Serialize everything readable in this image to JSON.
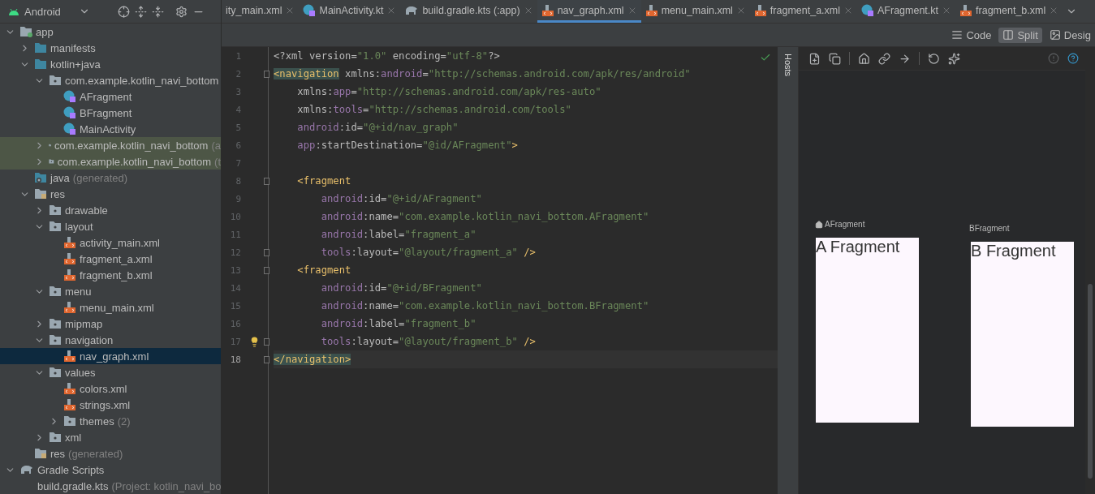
{
  "project_view": {
    "title": "Android"
  },
  "tree": [
    {
      "label": "app",
      "kind": "module",
      "expanded": true,
      "selected": false,
      "highlighted": false,
      "children": [
        {
          "label": "manifests",
          "kind": "folder",
          "expanded": false,
          "selected": false,
          "highlighted": false
        },
        {
          "label": "kotlin+java",
          "kind": "folder",
          "expanded": true,
          "selected": false,
          "highlighted": false,
          "children": [
            {
              "label": "com.example.kotlin_navi_bottom",
              "kind": "package",
              "expanded": true,
              "selected": false,
              "highlighted": false,
              "children": [
                {
                  "label": "AFragment",
                  "kind": "kotlin",
                  "selected": false,
                  "highlighted": false
                },
                {
                  "label": "BFragment",
                  "kind": "kotlin",
                  "selected": false,
                  "highlighted": false
                },
                {
                  "label": "MainActivity",
                  "kind": "kotlin",
                  "selected": false,
                  "highlighted": false
                }
              ]
            },
            {
              "label": "com.example.kotlin_navi_bottom",
              "suffix": "(a",
              "kind": "package",
              "expanded": false,
              "selected": false,
              "highlighted": true
            },
            {
              "label": "com.example.kotlin_navi_bottom",
              "suffix": "(t",
              "kind": "package",
              "expanded": false,
              "selected": false,
              "highlighted": true
            }
          ]
        },
        {
          "label": "java",
          "suffix": "(generated)",
          "kind": "generated",
          "selected": false,
          "highlighted": false
        },
        {
          "label": "res",
          "kind": "res",
          "expanded": true,
          "selected": false,
          "highlighted": false,
          "children": [
            {
              "label": "drawable",
              "kind": "package",
              "expanded": false,
              "selected": false,
              "highlighted": false
            },
            {
              "label": "layout",
              "kind": "package",
              "expanded": true,
              "selected": false,
              "highlighted": false,
              "children": [
                {
                  "label": "activity_main.xml",
                  "kind": "xml",
                  "selected": false,
                  "highlighted": false
                },
                {
                  "label": "fragment_a.xml",
                  "kind": "xml",
                  "selected": false,
                  "highlighted": false
                },
                {
                  "label": "fragment_b.xml",
                  "kind": "xml",
                  "selected": false,
                  "highlighted": false
                }
              ]
            },
            {
              "label": "menu",
              "kind": "package",
              "expanded": true,
              "selected": false,
              "highlighted": false,
              "children": [
                {
                  "label": "menu_main.xml",
                  "kind": "xml",
                  "selected": false,
                  "highlighted": false
                }
              ]
            },
            {
              "label": "mipmap",
              "kind": "package",
              "expanded": false,
              "selected": false,
              "highlighted": false
            },
            {
              "label": "navigation",
              "kind": "package",
              "expanded": true,
              "selected": false,
              "highlighted": false,
              "children": [
                {
                  "label": "nav_graph.xml",
                  "kind": "xml",
                  "selected": true
                }
              ]
            },
            {
              "label": "values",
              "kind": "package",
              "expanded": true,
              "selected": false,
              "highlighted": false,
              "children": [
                {
                  "label": "colors.xml",
                  "kind": "xml",
                  "selected": false,
                  "highlighted": false
                },
                {
                  "label": "strings.xml",
                  "kind": "xml",
                  "selected": false,
                  "highlighted": false
                },
                {
                  "label": "themes",
                  "suffix": "(2)",
                  "kind": "package",
                  "expanded": false,
                  "selected": false,
                  "highlighted": false
                }
              ]
            },
            {
              "label": "xml",
              "kind": "package",
              "expanded": false,
              "selected": false,
              "highlighted": false
            }
          ]
        },
        {
          "label": "res",
          "suffix": "(generated)",
          "kind": "res",
          "selected": false,
          "highlighted": false
        }
      ]
    },
    {
      "label": "Gradle Scripts",
      "kind": "gradle",
      "expanded": true,
      "selected": false,
      "highlighted": false,
      "children": [
        {
          "label": "build.gradle.kts",
          "suffix": "(Project: kotlin_navi_bo",
          "kind": "gradle-kts",
          "selected": false,
          "highlighted": false
        }
      ]
    }
  ],
  "tabs": [
    {
      "label": "ity_main.xml",
      "kind": "none",
      "selected": false
    },
    {
      "label": "MainActivity.kt",
      "kind": "kotlin",
      "selected": false
    },
    {
      "label": "build.gradle.kts (:app)",
      "kind": "gradle",
      "selected": false
    },
    {
      "label": "nav_graph.xml",
      "kind": "xml",
      "selected": true
    },
    {
      "label": "menu_main.xml",
      "kind": "xml",
      "selected": false
    },
    {
      "label": "fragment_a.xml",
      "kind": "xml",
      "selected": false
    },
    {
      "label": "AFragment.kt",
      "kind": "kotlin",
      "selected": false
    },
    {
      "label": "fragment_b.xml",
      "kind": "xml",
      "selected": false
    }
  ],
  "view_modes": [
    {
      "label": "Code",
      "kind": "code",
      "selected": false
    },
    {
      "label": "Split",
      "kind": "split",
      "selected": true
    },
    {
      "label": "Desig",
      "kind": "design",
      "selected": false
    }
  ],
  "code_lines": [
    {
      "number": "1",
      "fold": false,
      "bulb": false,
      "current": false,
      "tokens": [
        {
          "kind": "plain",
          "text": "<?xml version="
        },
        {
          "kind": "str",
          "text": "\"1.0\" "
        },
        {
          "kind": "plain",
          "text": "encoding="
        },
        {
          "kind": "str",
          "text": "\"utf-8\""
        },
        {
          "kind": "plain",
          "text": "?>"
        }
      ]
    },
    {
      "number": "2",
      "fold": true,
      "bulb": false,
      "current": false,
      "tokens": [
        {
          "kind": "match",
          "text": "<navigation"
        },
        {
          "kind": "plain",
          "text": " xmlns:"
        },
        {
          "kind": "ns",
          "text": "android"
        },
        {
          "kind": "plain",
          "text": "="
        },
        {
          "kind": "str",
          "text": "\"http://schemas.android.com/apk/res/android\""
        }
      ]
    },
    {
      "number": "3",
      "fold": false,
      "bulb": false,
      "current": false,
      "tokens": [
        {
          "kind": "plain",
          "text": "    xmlns:"
        },
        {
          "kind": "ns",
          "text": "app"
        },
        {
          "kind": "plain",
          "text": "="
        },
        {
          "kind": "str",
          "text": "\"http://schemas.android.com/apk/res-auto\""
        }
      ]
    },
    {
      "number": "4",
      "fold": false,
      "bulb": false,
      "current": false,
      "tokens": [
        {
          "kind": "plain",
          "text": "    xmlns:"
        },
        {
          "kind": "ns",
          "text": "tools"
        },
        {
          "kind": "plain",
          "text": "="
        },
        {
          "kind": "str",
          "text": "\"http://schemas.android.com/tools\""
        }
      ]
    },
    {
      "number": "5",
      "fold": false,
      "bulb": false,
      "current": false,
      "tokens": [
        {
          "kind": "ns",
          "text": "    android"
        },
        {
          "kind": "plain",
          "text": ":id="
        },
        {
          "kind": "str",
          "text": "\"@+id/nav_graph\""
        }
      ]
    },
    {
      "number": "6",
      "fold": false,
      "bulb": false,
      "current": false,
      "tokens": [
        {
          "kind": "ns",
          "text": "    app"
        },
        {
          "kind": "plain",
          "text": ":startDestination="
        },
        {
          "kind": "str",
          "text": "\"@id/AFragment\""
        },
        {
          "kind": "tag",
          "text": ">"
        }
      ]
    },
    {
      "number": "7",
      "fold": false,
      "bulb": false,
      "current": false
    },
    {
      "number": "8",
      "fold": true,
      "bulb": false,
      "current": false,
      "tokens": [
        {
          "kind": "tag",
          "text": "    <fragment"
        }
      ]
    },
    {
      "number": "9",
      "fold": false,
      "bulb": false,
      "current": false,
      "tokens": [
        {
          "kind": "ns",
          "text": "        android"
        },
        {
          "kind": "plain",
          "text": ":id="
        },
        {
          "kind": "str",
          "text": "\"@+id/AFragment\""
        }
      ]
    },
    {
      "number": "10",
      "fold": false,
      "bulb": false,
      "current": false,
      "tokens": [
        {
          "kind": "ns",
          "text": "        android"
        },
        {
          "kind": "plain",
          "text": ":name="
        },
        {
          "kind": "str",
          "text": "\"com.example.kotlin_navi_bottom.AFragment\""
        }
      ]
    },
    {
      "number": "11",
      "fold": false,
      "bulb": false,
      "current": false,
      "tokens": [
        {
          "kind": "ns",
          "text": "        android"
        },
        {
          "kind": "plain",
          "text": ":label="
        },
        {
          "kind": "str",
          "text": "\"fragment_a\""
        }
      ]
    },
    {
      "number": "12",
      "fold": true,
      "bulb": false,
      "current": false,
      "tokens": [
        {
          "kind": "ns",
          "text": "        tools"
        },
        {
          "kind": "plain",
          "text": ":layout="
        },
        {
          "kind": "str",
          "text": "\"@layout/fragment_a\" "
        },
        {
          "kind": "tag",
          "text": "/>"
        }
      ]
    },
    {
      "number": "13",
      "fold": true,
      "bulb": false,
      "current": false,
      "tokens": [
        {
          "kind": "tag",
          "text": "    <fragment"
        }
      ]
    },
    {
      "number": "14",
      "fold": false,
      "bulb": false,
      "current": false,
      "tokens": [
        {
          "kind": "ns",
          "text": "        android"
        },
        {
          "kind": "plain",
          "text": ":id="
        },
        {
          "kind": "str",
          "text": "\"@+id/BFragment\""
        }
      ]
    },
    {
      "number": "15",
      "fold": false,
      "bulb": false,
      "current": false,
      "tokens": [
        {
          "kind": "ns",
          "text": "        android"
        },
        {
          "kind": "plain",
          "text": ":name="
        },
        {
          "kind": "str",
          "text": "\"com.example.kotlin_navi_bottom.BFragment\""
        }
      ]
    },
    {
      "number": "16",
      "fold": false,
      "bulb": false,
      "current": false,
      "tokens": [
        {
          "kind": "ns",
          "text": "        android"
        },
        {
          "kind": "plain",
          "text": ":label="
        },
        {
          "kind": "str",
          "text": "\"fragment_b\""
        }
      ]
    },
    {
      "number": "17",
      "fold": true,
      "bulb": true,
      "current": false,
      "tokens": [
        {
          "kind": "ns",
          "text": "        tools"
        },
        {
          "kind": "plain",
          "text": ":layout="
        },
        {
          "kind": "str",
          "text": "\"@layout/fragment_b\" "
        },
        {
          "kind": "tag",
          "text": "/>"
        }
      ]
    },
    {
      "number": "18",
      "fold": true,
      "bulb": false,
      "current": true,
      "tokens": [
        {
          "kind": "match",
          "text": "</navigation>"
        }
      ]
    }
  ],
  "side_strip": {
    "label": "Hosts"
  },
  "destinations": [
    {
      "label": "AFragment",
      "start": true,
      "content": "A Fragment"
    },
    {
      "label": "BFragment",
      "start": false,
      "content": "B Fragment"
    }
  ]
}
